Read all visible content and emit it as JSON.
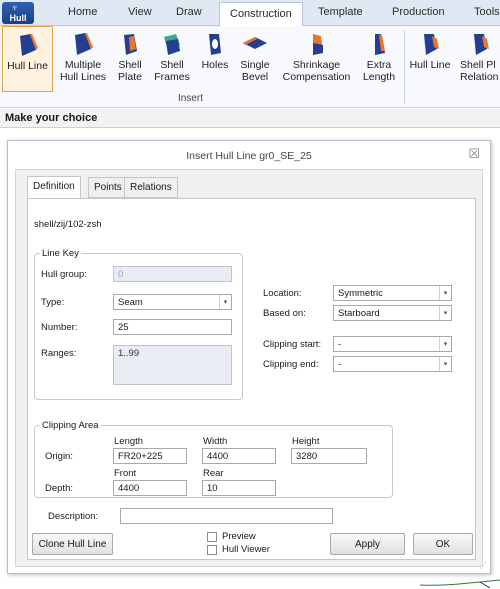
{
  "app": {
    "button_label": "Hull"
  },
  "ribbon_tabs": [
    "Home",
    "View",
    "Draw",
    "Construction",
    "Template",
    "Production",
    "Tools"
  ],
  "ribbon": {
    "buttons": [
      {
        "line1": "Hull Line",
        "line2": ""
      },
      {
        "line1": "Multiple",
        "line2": "Hull Lines"
      },
      {
        "line1": "Shell",
        "line2": "Plate"
      },
      {
        "line1": "Shell",
        "line2": "Frames"
      },
      {
        "line1": "Holes",
        "line2": ""
      },
      {
        "line1": "Single",
        "line2": "Bevel"
      },
      {
        "line1": "Shrinkage",
        "line2": "Compensation"
      },
      {
        "line1": "Extra",
        "line2": "Length"
      },
      {
        "line1": "Hull Line",
        "line2": ""
      },
      {
        "line1": "Shell Pl",
        "line2": "Relation"
      }
    ],
    "group_label": "Insert"
  },
  "prompt": "Make your choice",
  "dialog": {
    "title": "Insert Hull Line gr0_SE_25",
    "close_glyph": "☒",
    "tabs": [
      "Definition",
      "Points",
      "Relations"
    ],
    "path": "shell/zij/102-zsh",
    "line_key": {
      "legend": "Line Key",
      "hull_group_label": "Hull group:",
      "hull_group_value": "0",
      "type_label": "Type:",
      "type_value": "Seam",
      "number_label": "Number:",
      "number_value": "25",
      "ranges_label": "Ranges:",
      "ranges_value": "1..99"
    },
    "location_label": "Location:",
    "location_value": "Symmetric",
    "based_on_label": "Based on:",
    "based_on_value": "Starboard",
    "clip_start_label": "Clipping start:",
    "clip_start_value": "-",
    "clip_end_label": "Clipping end:",
    "clip_end_value": "-",
    "clipping_area": {
      "legend": "Clipping Area",
      "length_label": "Length",
      "width_label": "Width",
      "height_label": "Height",
      "origin_label": "Origin:",
      "origin_length": "FR20+225",
      "origin_width": "4400",
      "origin_height": "3280",
      "front_label": "Front",
      "rear_label": "Rear",
      "depth_label": "Depth:",
      "depth_front": "4400",
      "depth_rear": "10"
    },
    "description_label": "Description:",
    "description_value": "",
    "clone_button": "Clone Hull Line",
    "preview_label": "Preview",
    "hull_viewer_label": "Hull Viewer",
    "apply_button": "Apply",
    "ok_button": "OK"
  },
  "colors": {
    "accent": "#e8a04b",
    "ribbon_bg": "#f7f9fc",
    "tabbar_bg": "#dfe8f3",
    "icon_blue": "#243f8f",
    "icon_orange": "#e8772e"
  }
}
